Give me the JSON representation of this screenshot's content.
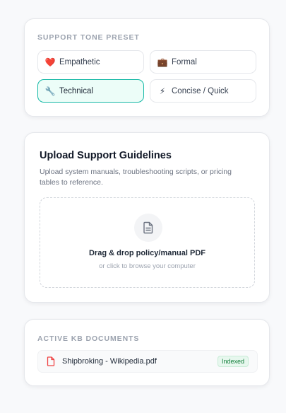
{
  "tone_preset": {
    "label": "SUPPORT TONE PRESET",
    "options": [
      {
        "label": "Empathetic",
        "icon": "heart-icon",
        "emoji": "❤️",
        "active": false
      },
      {
        "label": "Formal",
        "icon": "briefcase-icon",
        "emoji": "💼",
        "active": false
      },
      {
        "label": "Technical",
        "icon": "wrench-icon",
        "emoji": "🔧",
        "active": true
      },
      {
        "label": "Concise / Quick",
        "icon": "lightning-icon",
        "emoji": "⚡",
        "active": false
      }
    ]
  },
  "upload": {
    "title": "Upload Support Guidelines",
    "description": "Upload system manuals, troubleshooting scripts, or pricing tables to reference.",
    "dropzone_title": "Drag & drop policy/manual PDF",
    "dropzone_subtitle": "or click to browse your computer",
    "icon": "document-icon"
  },
  "kb": {
    "label": "ACTIVE KB DOCUMENTS",
    "documents": [
      {
        "name": "Shipbroking - Wikipedia.pdf",
        "status": "Indexed",
        "icon": "pdf-file-icon"
      }
    ]
  },
  "colors": {
    "accent": "#14b8a6",
    "accent_bg": "#ecfdf8",
    "badge_text": "#15803d",
    "badge_bg": "#e7f7ee",
    "pdf_red": "#ef4444"
  }
}
